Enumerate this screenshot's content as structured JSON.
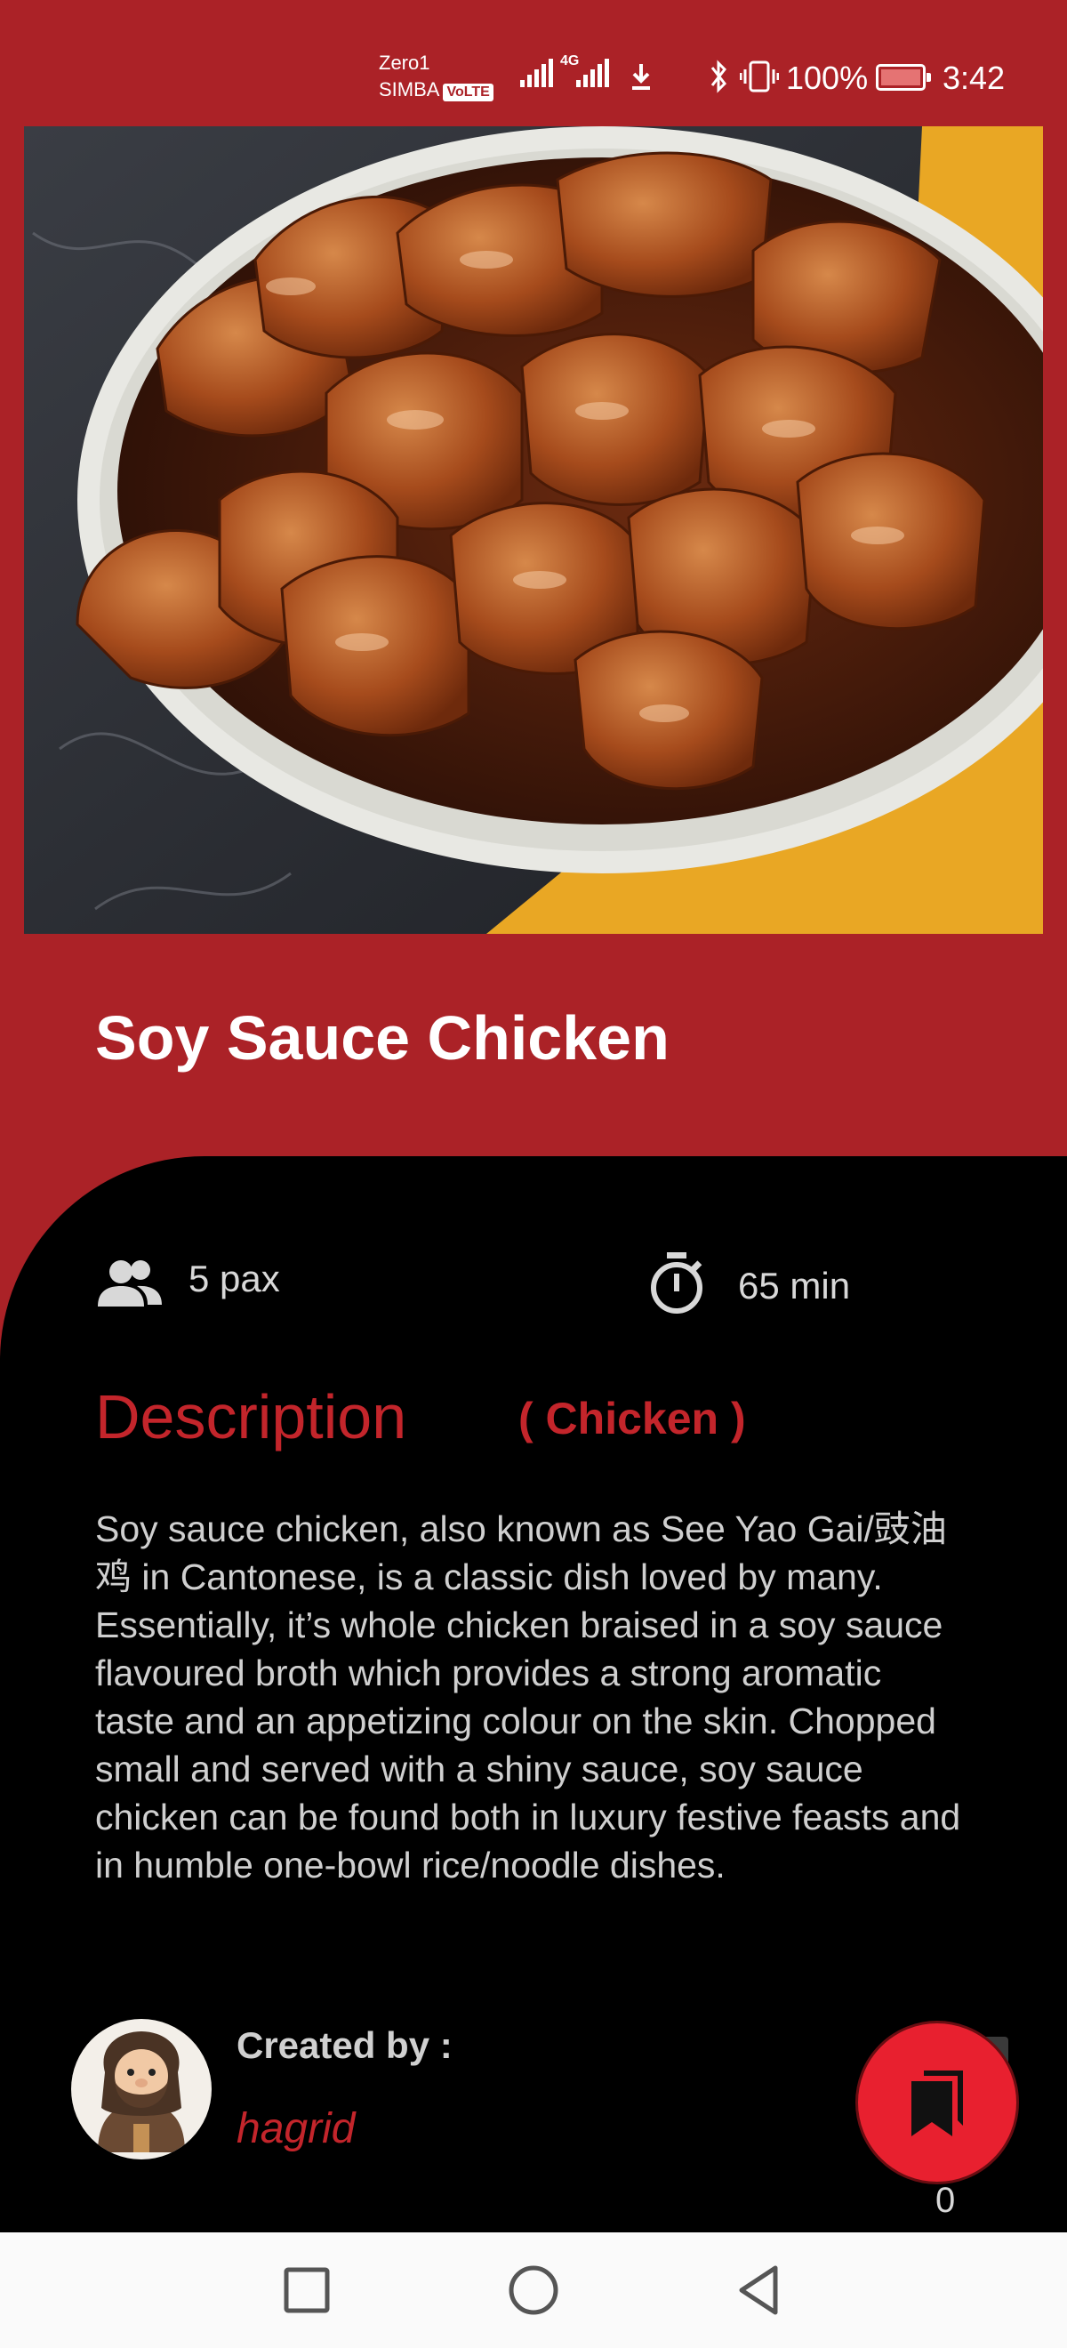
{
  "status_bar": {
    "carrier_line1": "Zero1",
    "carrier_line2": "SIMBA",
    "volte_badge": "VoLTE",
    "network_type": "4G",
    "battery_percent": "100%",
    "time": "3:42"
  },
  "recipe": {
    "title": "Soy Sauce Chicken",
    "servings": "5 pax",
    "duration": "65 min",
    "description_heading": "Description",
    "category": "( Chicken )",
    "description": "Soy sauce chicken, also known as See Yao Gai/豉油鸡 in Cantonese, is a classic dish loved by many. Essentially, it’s whole chicken braised in a soy sauce flavoured broth which provides a strong aromatic taste and an appetizing colour on the skin. Chopped small and served with a shiny sauce, soy sauce chicken can be found both in luxury festive feasts and in humble one-bowl rice/noodle dishes."
  },
  "author": {
    "created_by_label": "Created by :",
    "name": "hagrid"
  },
  "bookmark": {
    "count": "0"
  },
  "icons": {
    "servings": "people-icon",
    "duration": "stopwatch-icon",
    "bookmark": "bookmark-icon"
  },
  "colors": {
    "accent_red": "#ab2227",
    "highlight_red": "#c3252b",
    "fab_red": "#e8202f",
    "panel_black": "#000000"
  }
}
